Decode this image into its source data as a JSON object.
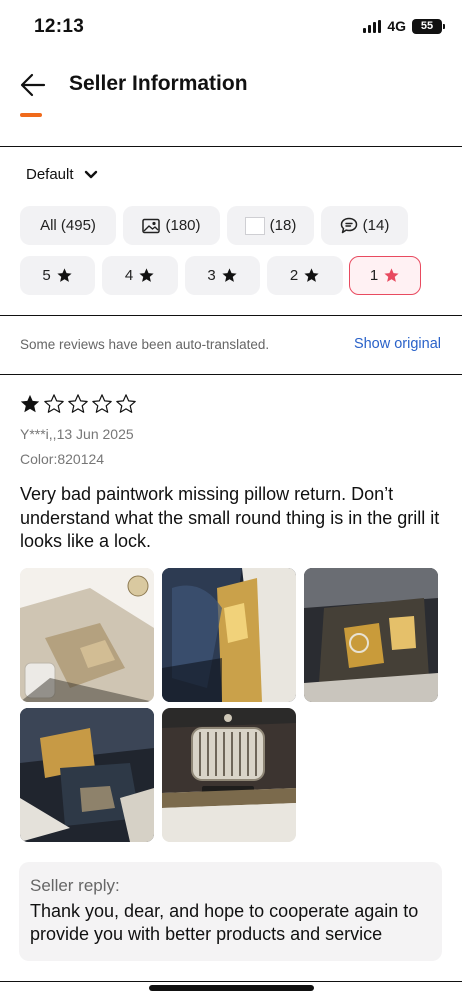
{
  "status_bar": {
    "time": "12:13",
    "network": "4G",
    "battery": "55"
  },
  "header": {
    "title": "Seller Information"
  },
  "sort": {
    "label": "Default"
  },
  "filters": {
    "row1": [
      {
        "label": "All (495)",
        "icon": ""
      },
      {
        "label": "(180)",
        "icon": "image-icon"
      },
      {
        "label": "(18)",
        "icon": "video-icon"
      },
      {
        "label": "(14)",
        "icon": "comment-icon"
      }
    ],
    "row2": [
      {
        "label": "5",
        "icon": "star-icon",
        "selected": false
      },
      {
        "label": "4",
        "icon": "star-icon",
        "selected": false
      },
      {
        "label": "3",
        "icon": "star-icon",
        "selected": false
      },
      {
        "label": "2",
        "icon": "star-icon",
        "selected": false
      },
      {
        "label": "1",
        "icon": "star-icon",
        "selected": true
      }
    ],
    "selected_color": "#e84a5f"
  },
  "translation": {
    "note": "Some reviews have been auto-translated.",
    "action": "Show original"
  },
  "review": {
    "rating": 1,
    "max_rating": 5,
    "author_date": "Y***i,,13 Jun 2025",
    "color": "Color:820124",
    "text": "Very bad paintwork missing pillow return. Don’t understand what the small round thing is in the grill it looks like a lock.",
    "photo_count": 5
  },
  "seller_reply": {
    "label": "Seller reply:",
    "text": "Thank you, dear, and hope to cooperate again to provide you with better products and service"
  },
  "colors": {
    "accent_link": "#2a62c9",
    "chip_bg": "#f2f2f4",
    "reply_bg": "#f4f3f4"
  }
}
